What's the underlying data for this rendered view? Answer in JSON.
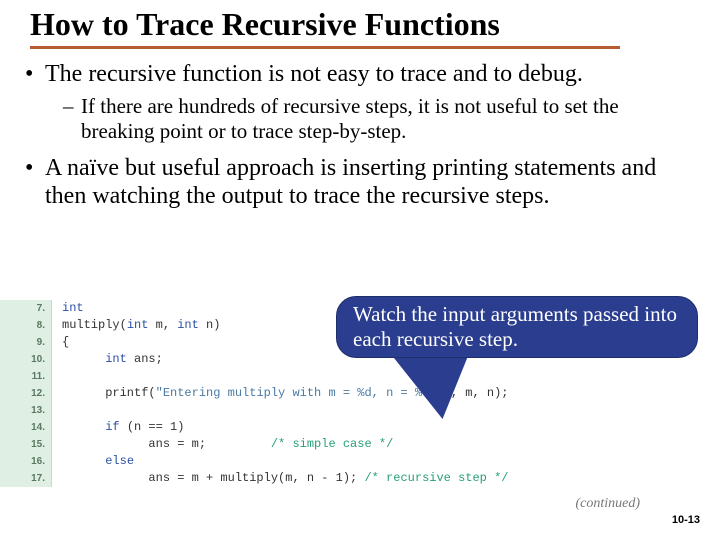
{
  "title": "How to Trace Recursive Functions",
  "bullets": {
    "b1": "The recursive function is not easy to trace and to debug.",
    "b1a": "If there are hundreds of recursive steps, it is not useful to set the breaking point or to trace step-by-step.",
    "b2": "A naïve but useful approach is inserting printing statements and then watching the output to trace the recursive steps."
  },
  "callout": "Watch the input arguments passed into each recursive step.",
  "code": {
    "ln7": "7.",
    "c7a": "int",
    "ln8": "8.",
    "c8a": "multiply(",
    "c8b": "int",
    "c8c": " m, ",
    "c8d": "int",
    "c8e": " n)",
    "ln9": "9.",
    "c9": "{",
    "ln10": "10.",
    "c10a": "      ",
    "c10b": "int",
    "c10c": " ans;",
    "ln11": "11.",
    "ln12": "12.",
    "c12a": "      printf(",
    "c12b": "\"Entering multiply with m = %d, n = %d\\n\"",
    "c12c": ", m, n);",
    "ln13": "13.",
    "ln14": "14.",
    "c14a": "      ",
    "c14b": "if",
    "c14c": " (n == 1)",
    "ln15": "15.",
    "c15a": "            ans = m;         ",
    "c15b": "/* simple case */",
    "ln16": "16.",
    "c16a": "      ",
    "c16b": "else",
    "ln17": "17.",
    "c17a": "            ans = m + multiply(m, n - 1); ",
    "c17b": "/* recursive step */"
  },
  "continued": "(continued)",
  "pagenum": "10-13"
}
